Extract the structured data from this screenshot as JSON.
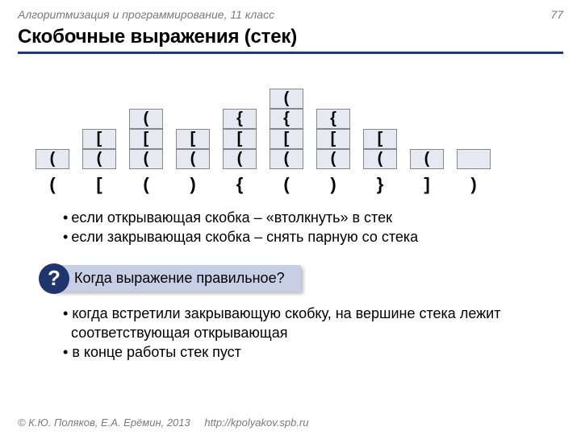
{
  "header": {
    "topic": "Алгоритмизация и программирование, 11 класс",
    "page": "77"
  },
  "title": "Скобочные выражения (стек)",
  "stacks": [
    {
      "cells": [
        "",
        "",
        "",
        "",
        "("
      ],
      "top_hidden": 4,
      "input": "("
    },
    {
      "cells": [
        "",
        "",
        "",
        "[",
        "("
      ],
      "top_hidden": 3,
      "input": "["
    },
    {
      "cells": [
        "",
        "",
        "(",
        "[",
        "("
      ],
      "top_hidden": 2,
      "input": "("
    },
    {
      "cells": [
        "",
        "",
        "",
        "[",
        "("
      ],
      "top_hidden": 3,
      "input": ")"
    },
    {
      "cells": [
        "",
        "",
        "{",
        "[",
        "("
      ],
      "top_hidden": 2,
      "input": "{"
    },
    {
      "cells": [
        "",
        "(",
        "{",
        "[",
        "("
      ],
      "top_hidden": 1,
      "input": "("
    },
    {
      "cells": [
        "",
        "",
        "{",
        "[",
        "("
      ],
      "top_hidden": 2,
      "input": ")"
    },
    {
      "cells": [
        "",
        "",
        "",
        "[",
        "("
      ],
      "top_hidden": 3,
      "input": "}"
    },
    {
      "cells": [
        "",
        "",
        "",
        "",
        "("
      ],
      "top_hidden": 4,
      "input": "]"
    },
    {
      "cells": [
        "",
        "",
        "",
        "",
        ""
      ],
      "top_hidden": 4,
      "input": ")"
    }
  ],
  "rules": [
    "если открывающая скобка – «втолкнуть» в стек",
    "если закрывающая скобка – снять парную со стека"
  ],
  "callout": {
    "mark": "?",
    "text": "Когда выражение правильное?"
  },
  "answers": [
    "когда встретили закрывающую скобку, на вершине стека лежит соответствующая открывающая",
    "в конце работы стек пуст"
  ],
  "footer": {
    "copy": "© К.Ю. Поляков, Е.А. Ерёмин, 2013",
    "url": "http://kpolyakov.spb.ru"
  }
}
